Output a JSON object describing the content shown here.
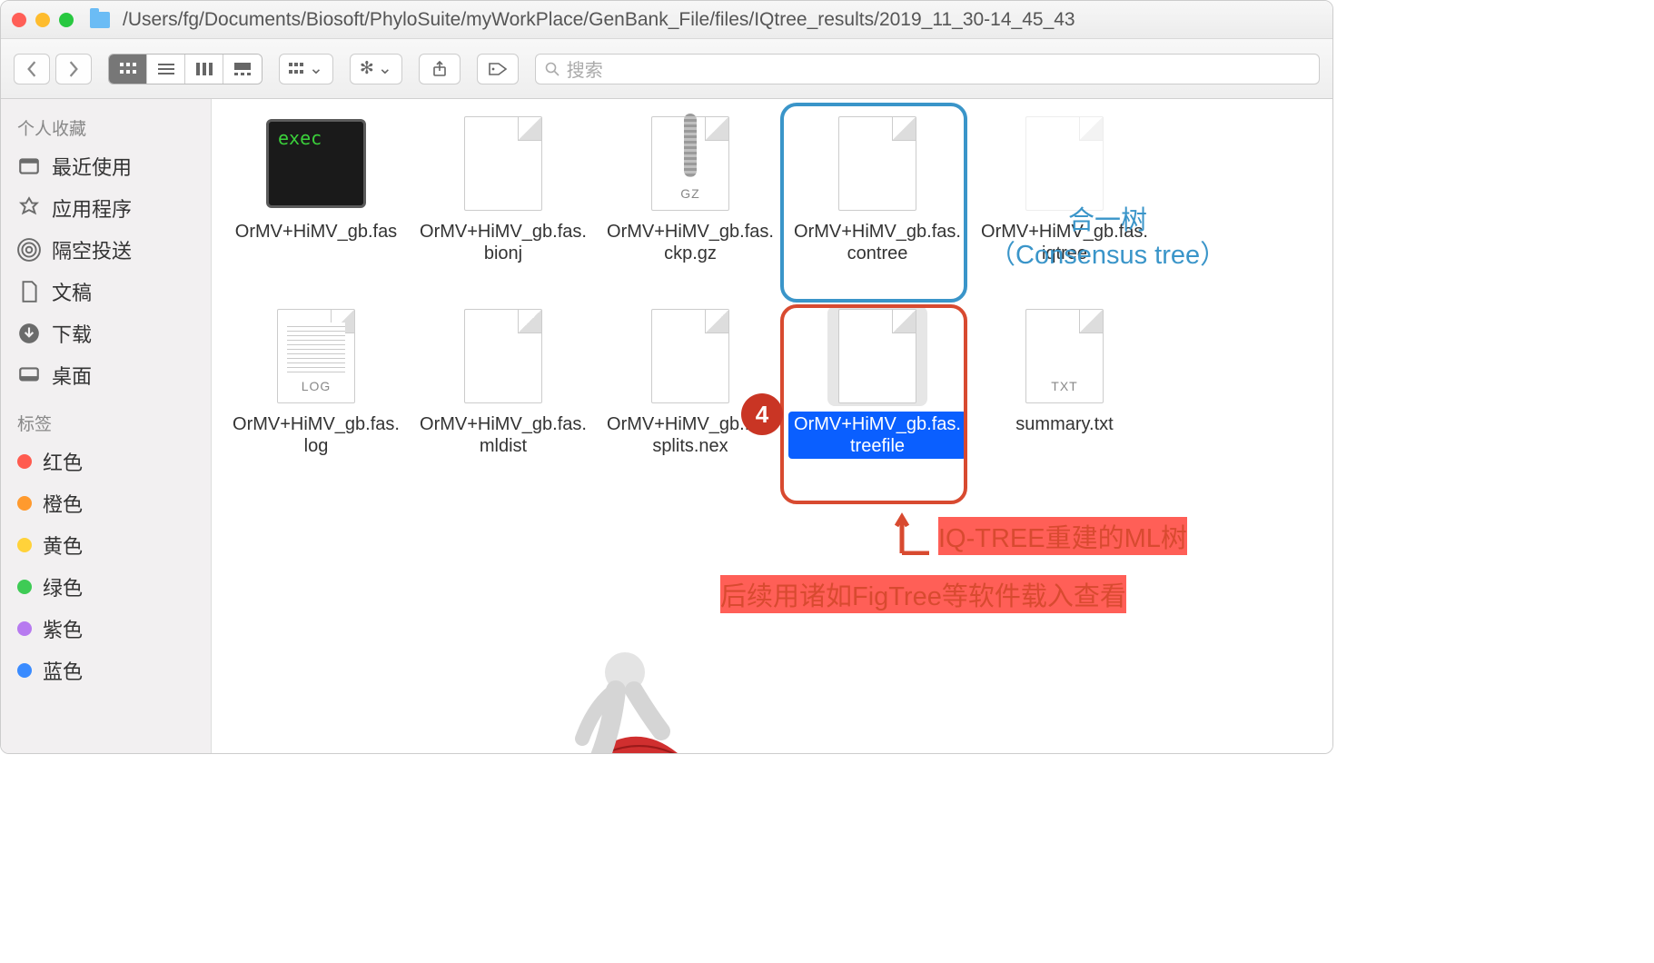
{
  "title_path": "/Users/fg/Documents/Biosoft/PhyloSuite/myWorkPlace/GenBank_File/files/IQtree_results/2019_11_30-14_45_43",
  "search": {
    "placeholder": "搜索"
  },
  "sidebar": {
    "favorites_header": "个人收藏",
    "items": [
      {
        "label": "最近使用"
      },
      {
        "label": "应用程序"
      },
      {
        "label": "隔空投送"
      },
      {
        "label": "文稿"
      },
      {
        "label": "下载"
      },
      {
        "label": "桌面"
      }
    ],
    "tags_header": "标签",
    "tags": [
      {
        "label": "红色",
        "color": "#ff5b4f"
      },
      {
        "label": "橙色",
        "color": "#ff9a2e"
      },
      {
        "label": "黄色",
        "color": "#ffd23a"
      },
      {
        "label": "绿色",
        "color": "#3ecb55"
      },
      {
        "label": "紫色",
        "color": "#b77af0"
      },
      {
        "label": "蓝色",
        "color": "#3a8bff"
      }
    ]
  },
  "files": [
    {
      "name": "OrMV+HiMV_gb.fas",
      "kind": "exec",
      "exec_label": "exec"
    },
    {
      "name": "OrMV+HiMV_gb.fas.bionj",
      "kind": "doc"
    },
    {
      "name": "OrMV+HiMV_gb.fas.ckp.gz",
      "kind": "gz",
      "tag": "GZ"
    },
    {
      "name": "OrMV+HiMV_gb.fas.contree",
      "kind": "doc"
    },
    {
      "name": "OrMV+HiMV_gb.fas.iqtree",
      "kind": "doc",
      "ghost": true
    },
    {
      "name": "OrMV+HiMV_gb.fas.log",
      "kind": "log",
      "tag": "LOG"
    },
    {
      "name": "OrMV+HiMV_gb.fas.mldist",
      "kind": "doc"
    },
    {
      "name": "OrMV+HiMV_gb.fas.splits.nex",
      "kind": "doc"
    },
    {
      "name": "OrMV+HiMV_gb.fas.treefile",
      "kind": "doc",
      "selected": true
    },
    {
      "name": "summary.txt",
      "kind": "txt",
      "tag": "TXT"
    }
  ],
  "annotations": {
    "badge": "4",
    "consensus_line1": "合一树",
    "consensus_line2": "（Consensus tree）",
    "ml_tree": "IQ-TREE重建的ML树",
    "followup": "后续用诸如FigTree等软件载入查看"
  }
}
